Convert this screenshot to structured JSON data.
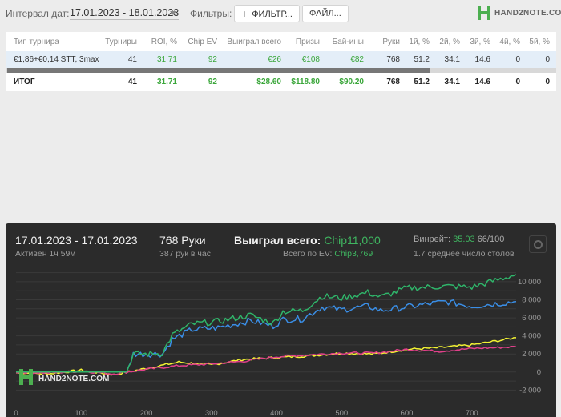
{
  "filter_bar": {
    "date_label": "Интервал дат:",
    "date_range": "17.01.2023 - 18.01.2023",
    "filters_label": "Фильтры:",
    "filter_button": "ФИЛЬТР...",
    "files_button": "ФАЙЛ...",
    "logo_text": "HAND2NOTE.COM"
  },
  "table": {
    "headers": [
      "Тип турнира",
      "Турниры",
      "ROI, %",
      "Chip EV",
      "Выиграл всего",
      "Призы",
      "Бай-ины",
      "Руки",
      "1й, %",
      "2й, %",
      "3й, %",
      "4й, %",
      "5й, %"
    ],
    "rows": [
      [
        "€1,86+€0,14 STT, 3max",
        "41",
        "31.71",
        "92",
        "€26",
        "€108",
        "€82",
        "768",
        "51.2",
        "34.1",
        "14.6",
        "0",
        "0"
      ]
    ],
    "total": [
      "ИТОГ",
      "41",
      "31.71",
      "92",
      "$28.60",
      "$118.80",
      "$90.20",
      "768",
      "51.2",
      "34.1",
      "14.6",
      "0",
      "0"
    ]
  },
  "stats": {
    "date_range": "17.01.2023 - 17.01.2023",
    "active_time": "Активен 1ч 59м",
    "hands_count": "768 Руки",
    "hands_per_hour": "387 рук в час",
    "won_total_label": "Выиграл всего:",
    "won_total_value": "Chip11,000",
    "ev_total_label": "Всего по EV:",
    "ev_total_value": "Chip3,769",
    "winrate_label": "Винрейт:",
    "winrate_value": "35.03",
    "winrate_ratio": "66/100",
    "avg_tables": "1.7 среднее число столов",
    "watermark": "HAND2NOTE.COM"
  },
  "colors": {
    "accent_green": "#3fb560",
    "won_line": "#2fb56a",
    "showdown_line": "#3a8ee6",
    "ev_line": "#f3f332",
    "nonshowdown_line": "#e0408a",
    "panel_dark": "#2b2b2b",
    "row_highlight": "#e4eef8"
  },
  "chart_data": {
    "type": "line",
    "x_ticks": [
      "0",
      "100",
      "200",
      "300",
      "400",
      "500",
      "600",
      "700"
    ],
    "y_ticks": [
      "-2 000",
      "0",
      "2 000",
      "4 000",
      "6 000",
      "8 000",
      "10 000"
    ],
    "xlim": [
      0,
      768
    ],
    "ylim": [
      -2500,
      11500
    ],
    "series": [
      {
        "color": "#2fb56a",
        "x": [
          0,
          100,
          170,
          180,
          210,
          225,
          240,
          270,
          310,
          360,
          395,
          410,
          440,
          470,
          500,
          540,
          560,
          600,
          660,
          700,
          768
        ],
        "y": [
          0,
          0,
          0,
          2000,
          2000,
          2100,
          4100,
          5300,
          5600,
          6300,
          5400,
          6700,
          6800,
          8400,
          8200,
          8800,
          8300,
          9300,
          9500,
          9400,
          10800
        ]
      },
      {
        "color": "#3a8ee6",
        "x": [
          0,
          100,
          170,
          180,
          210,
          225,
          240,
          270,
          310,
          360,
          395,
          410,
          440,
          470,
          500,
          540,
          560,
          600,
          660,
          700,
          768
        ],
        "y": [
          0,
          0,
          0,
          2000,
          2000,
          2000,
          3600,
          4700,
          4900,
          5700,
          5100,
          5800,
          5900,
          7200,
          6900,
          7300,
          6800,
          7200,
          7800,
          7300,
          7800
        ]
      },
      {
        "color": "#f3f332",
        "x": [
          0,
          50,
          100,
          150,
          200,
          250,
          300,
          350,
          400,
          450,
          500,
          550,
          600,
          650,
          700,
          768
        ],
        "y": [
          -100,
          -200,
          200,
          -300,
          400,
          1100,
          800,
          1400,
          1600,
          1800,
          2100,
          2000,
          2500,
          2700,
          3000,
          3800
        ]
      },
      {
        "color": "#e0408a",
        "x": [
          0,
          50,
          100,
          150,
          200,
          250,
          300,
          350,
          400,
          450,
          500,
          550,
          600,
          650,
          700,
          768
        ],
        "y": [
          0,
          -100,
          100,
          -200,
          300,
          700,
          900,
          1200,
          1700,
          1900,
          2100,
          2100,
          2500,
          2300,
          2600,
          2800
        ]
      }
    ]
  }
}
